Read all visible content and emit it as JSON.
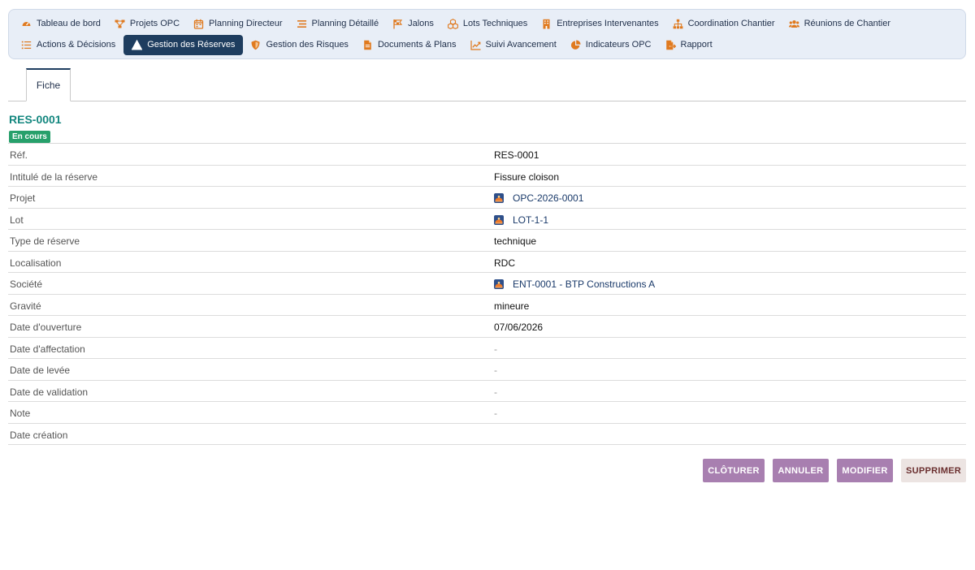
{
  "nav": {
    "row1": [
      {
        "label": "Tableau de bord",
        "icon": "dashboard-icon"
      },
      {
        "label": "Projets OPC",
        "icon": "project-nodes-icon"
      },
      {
        "label": "Planning Directeur",
        "icon": "calendar-icon"
      },
      {
        "label": "Planning Détaillé",
        "icon": "lines-icon"
      },
      {
        "label": "Jalons",
        "icon": "flag-icon"
      },
      {
        "label": "Lots Techniques",
        "icon": "cubes-icon"
      },
      {
        "label": "Entreprises Intervenantes",
        "icon": "building-icon"
      },
      {
        "label": "Coordination Chantier",
        "icon": "hierarchy-icon"
      },
      {
        "label": "Réunions de Chantier",
        "icon": "users-icon"
      }
    ],
    "row2": [
      {
        "label": "Actions & Décisions",
        "icon": "list-icon"
      },
      {
        "label": "Gestion des Réserves",
        "icon": "warning-icon",
        "active": true
      },
      {
        "label": "Gestion des Risques",
        "icon": "shield-icon"
      },
      {
        "label": "Documents & Plans",
        "icon": "document-icon"
      },
      {
        "label": "Suivi Avancement",
        "icon": "chart-line-icon"
      },
      {
        "label": "Indicateurs OPC",
        "icon": "pie-chart-icon"
      },
      {
        "label": "Rapport",
        "icon": "file-export-icon"
      }
    ]
  },
  "tabs": {
    "fiche": "Fiche"
  },
  "record": {
    "title": "RES-0001",
    "status": "En cours",
    "fields": [
      {
        "label": "Réf.",
        "value": "RES-0001",
        "kind": "text"
      },
      {
        "label": "Intitulé de la réserve",
        "value": "Fissure cloison",
        "kind": "text"
      },
      {
        "label": "Projet",
        "value": "OPC-2026-0001",
        "kind": "link"
      },
      {
        "label": "Lot",
        "value": "LOT-1-1",
        "kind": "link"
      },
      {
        "label": "Type de réserve",
        "value": "technique",
        "kind": "text"
      },
      {
        "label": "Localisation",
        "value": "RDC",
        "kind": "text"
      },
      {
        "label": "Société",
        "value": "ENT-0001 - BTP Constructions A",
        "kind": "link"
      },
      {
        "label": "Gravité",
        "value": "mineure",
        "kind": "text"
      },
      {
        "label": "Date d'ouverture",
        "value": "07/06/2026",
        "kind": "text"
      },
      {
        "label": "Date d'affectation",
        "value": "-",
        "kind": "dash"
      },
      {
        "label": "Date de levée",
        "value": "-",
        "kind": "dash"
      },
      {
        "label": "Date de validation",
        "value": "-",
        "kind": "dash"
      },
      {
        "label": "Note",
        "value": "-",
        "kind": "dash"
      },
      {
        "label": "Date création",
        "value": "",
        "kind": "text"
      }
    ]
  },
  "actions": {
    "cloturer": "CLÔTURER",
    "annuler": "ANNULER",
    "modifier": "MODIFIER",
    "supprimer": "SUPPRIMER"
  },
  "colors": {
    "nav_active": "#1e3d5f",
    "icon_orange": "#e07a1f",
    "title_teal": "#14877f",
    "badge_green": "#27a06b",
    "button_purple": "#a87fb0"
  }
}
